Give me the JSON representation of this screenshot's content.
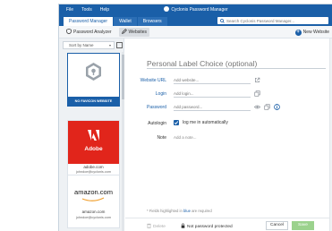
{
  "window": {
    "app_title": "Cyclonis Password Manager",
    "menu": [
      "File",
      "Tools",
      "Help"
    ]
  },
  "tabs": [
    {
      "label": "Password Manager",
      "active": true
    },
    {
      "label": "Wallet",
      "active": false
    },
    {
      "label": "Browsers",
      "active": false
    }
  ],
  "search": {
    "placeholder": "Search Cyclonis Password Manager..."
  },
  "toolbar": {
    "password_analyzer": "Password Analyzer",
    "websites": "Websites",
    "new_website": "New Website"
  },
  "sidebar": {
    "sort_label": "Sort by Name",
    "cards": [
      {
        "name": "",
        "tile_text": "NO FAVICON WEBSITE",
        "tile_color": "#1a5fa8",
        "user": "",
        "selected": true
      },
      {
        "name": "adobe.com",
        "tile_text": "Adobe",
        "tile_color": "#e1251b",
        "user": "johndoe@cyclonis.com",
        "selected": false
      },
      {
        "name": "amazon.com",
        "tile_text": "amazon.com",
        "tile_color": "#ffffff",
        "user": "johndoe@cyclonis.com",
        "selected": false
      }
    ]
  },
  "form": {
    "title_placeholder": "Personal Label Choice (optional)",
    "url_label": "Website URL",
    "url_placeholder": "Add website...",
    "login_label": "Login",
    "login_placeholder": "Add login...",
    "password_label": "Password",
    "password_placeholder": "Add password...",
    "autologin_label": "Autologin",
    "autologin_text": "log me in automatically",
    "autologin_checked": true,
    "note_label": "Note",
    "note_placeholder": "Add a note...",
    "hint_prefix": "* Fields highlighted in",
    "hint_blue": "blue",
    "hint_suffix": "are required"
  },
  "footer": {
    "delete_label": "Delete",
    "protection_label": "Not password protected",
    "cancel_label": "Cancel",
    "save_label": "Save"
  },
  "colors": {
    "accent": "#1a5fa8",
    "save_disabled": "#9bd28d",
    "adobe_red": "#e1251b"
  }
}
